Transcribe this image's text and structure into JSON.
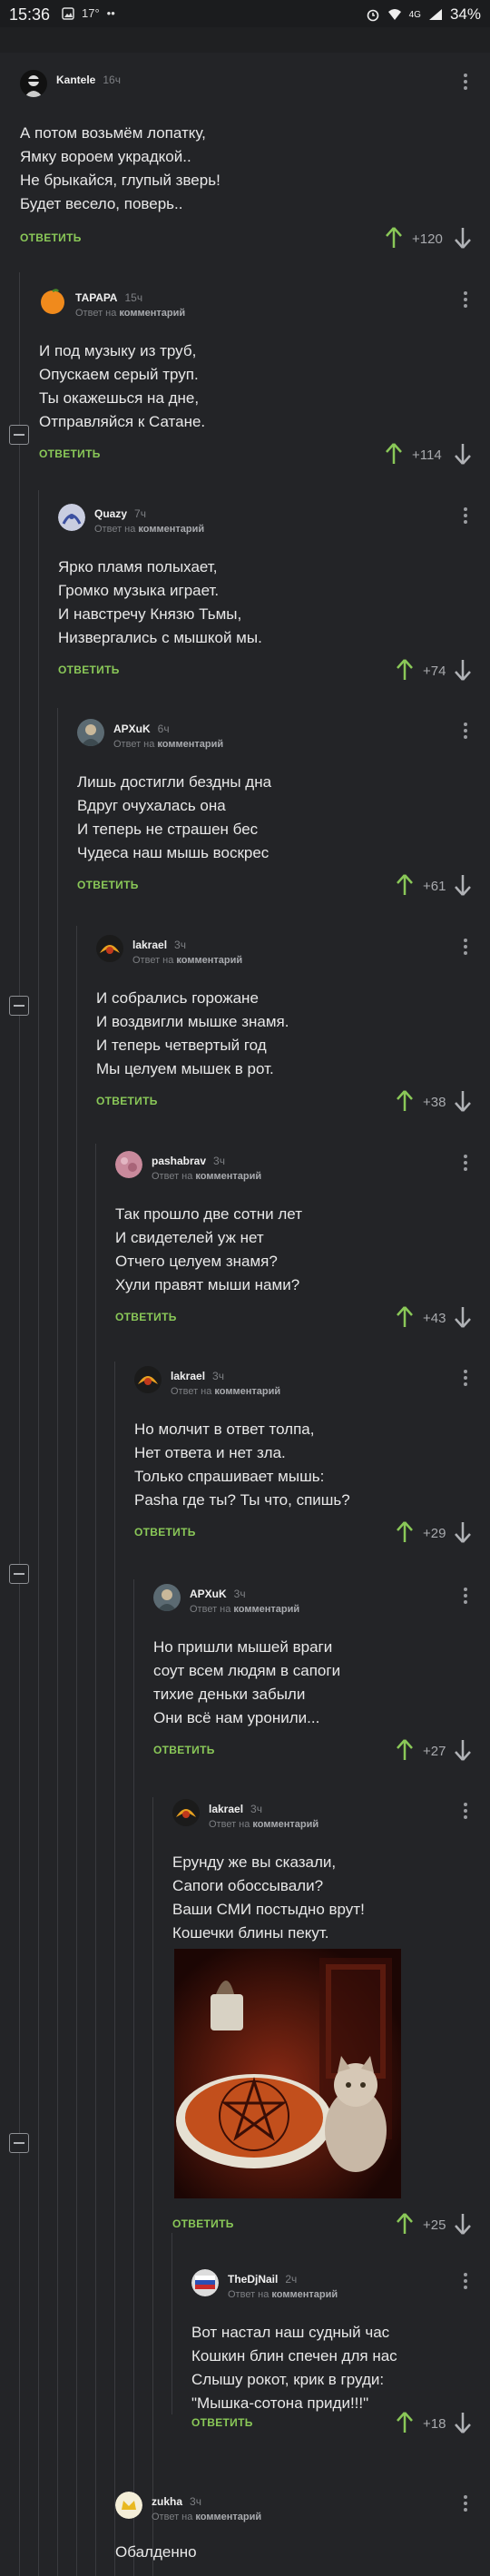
{
  "status_bar": {
    "time": "15:36",
    "temperature": "17°",
    "battery": "34%",
    "network": "4G"
  },
  "labels": {
    "answer": "ОТВЕТИТЬ",
    "reply_prefix": "Ответ на",
    "reply_target": "комментарий"
  },
  "comments": [
    {
      "user": "Kantele",
      "time": "16ч",
      "rating": "+120",
      "lines": [
        "А потом возьмём лопатку,",
        "Ямку вороем украдкой..",
        "Не брыкайся, глупый зверь!",
        "Будет весело, поверь.."
      ]
    },
    {
      "user": "ТАРАРА",
      "time": "15ч",
      "rating": "+114",
      "lines": [
        "И под музыку из труб,",
        "Опускаем серый труп.",
        "Ты окажешься на дне,",
        "Отправляйся к Сатане."
      ]
    },
    {
      "user": "Quazy",
      "time": "7ч",
      "rating": "+74",
      "lines": [
        "Ярко пламя полыхает,",
        "Громко музыка играет.",
        "И навстречу Князю Тьмы,",
        "Низвергались с мышкой мы."
      ]
    },
    {
      "user": "APXuK",
      "time": "6ч",
      "rating": "+61",
      "lines": [
        "Лишь достигли бездны дна",
        "Вдруг очухалась она",
        "И теперь не страшен бес",
        "Чудеса наш мышь воскрес"
      ]
    },
    {
      "user": "lakrael",
      "time": "3ч",
      "rating": "+38",
      "lines": [
        "И собрались горожане",
        "И воздвигли мышке знамя.",
        "И теперь четвертый год",
        "Мы целуем мышек в рот."
      ]
    },
    {
      "user": "pashabrav",
      "time": "3ч",
      "rating": "+43",
      "lines": [
        "Так прошло две сотни лет",
        "И свидетелей уж нет",
        "Отчего целуем знамя?",
        "Хули правят мыши нами?"
      ]
    },
    {
      "user": "lakrael",
      "time": "3ч",
      "rating": "+29",
      "lines": [
        "Но молчит в ответ толпа,",
        "Нет ответа и нет зла.",
        "Только спрашивает мышь:",
        "Pasha где ты? Ты что, спишь?"
      ]
    },
    {
      "user": "APXuK",
      "time": "3ч",
      "rating": "+27",
      "lines": [
        "Но пришли мышей враги",
        "соут всем людям в сапоги",
        "тихие деньки забыли",
        "Они всё нам уронили..."
      ]
    },
    {
      "user": "lakrael",
      "time": "3ч",
      "rating": "+25",
      "lines": [
        "Ерунду же вы сказали,",
        "Сапоги обоссывали?",
        "Ваши СМИ постыдно врут!",
        "Кошечки блины пекут."
      ]
    },
    {
      "user": "TheDjNail",
      "time": "2ч",
      "rating": "+18",
      "lines": [
        "Вот настал наш судный час",
        "Кошкин блин спечен для нас",
        "Слышу рокот, крик в груди:",
        "\"Мышка-сотона приди!!!\""
      ]
    },
    {
      "user": "zukha",
      "time": "3ч",
      "rating": "",
      "lines": [
        "Обалденно"
      ]
    }
  ],
  "colors": {
    "background": "#232427",
    "answer_green": "#8ac858",
    "rating_gray": "#a8aaae"
  }
}
